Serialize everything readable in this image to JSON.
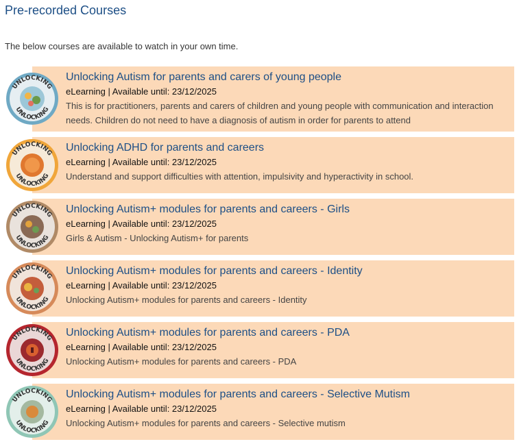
{
  "page": {
    "title": "Pre-recorded Courses",
    "intro": "The below courses are available to watch in your own time."
  },
  "courses": [
    {
      "title": "Unlocking Autism for parents and carers of young people",
      "meta": "eLearning | Available until: 23/12/2025",
      "description": "This is for practitioners, parents and carers of children and young people with communication and interaction needs. Children do not need to have a diagnosis of autism in order for parents to attend",
      "badge_icon": "unlocking-autism-badge-icon",
      "badge_color": "#7bb7c9"
    },
    {
      "title": "Unlocking ADHD for parents and careers",
      "meta": "eLearning | Available until: 23/12/2025",
      "description": "Understand and support difficulties with attention, impulsivity and hyperactivity in school.",
      "badge_icon": "unlocking-adhd-badge-icon",
      "badge_color": "#f0a63a"
    },
    {
      "title": "Unlocking Autism+ modules for parents and careers - Girls",
      "meta": "eLearning | Available until: 23/12/2025",
      "description": "Girls & Autism - Unlocking Autism+ for parents",
      "badge_icon": "unlocking-girls-badge-icon",
      "badge_color": "#c9a27a"
    },
    {
      "title": "Unlocking Autism+ modules for parents and careers - Identity",
      "meta": "eLearning | Available until: 23/12/2025",
      "description": "Unlocking Autism+ modules for parents and careers - Identity",
      "badge_icon": "unlocking-identity-badge-icon",
      "badge_color": "#d68a5a"
    },
    {
      "title": "Unlocking Autism+ modules for parents and careers - PDA",
      "meta": "eLearning | Available until: 23/12/2025",
      "description": "Unlocking Autism+ modules for parents and careers - PDA",
      "badge_icon": "unlocking-pda-badge-icon",
      "badge_color": "#b5262e"
    },
    {
      "title": "Unlocking Autism+ modules for parents and careers - Selective Mutism",
      "meta": "eLearning | Available until: 23/12/2025",
      "description": "Unlocking Autism+ modules for parents and careers - Selective mutism",
      "badge_icon": "unlocking-selective-mutism-badge-icon",
      "badge_color": "#8fc6b5"
    }
  ]
}
